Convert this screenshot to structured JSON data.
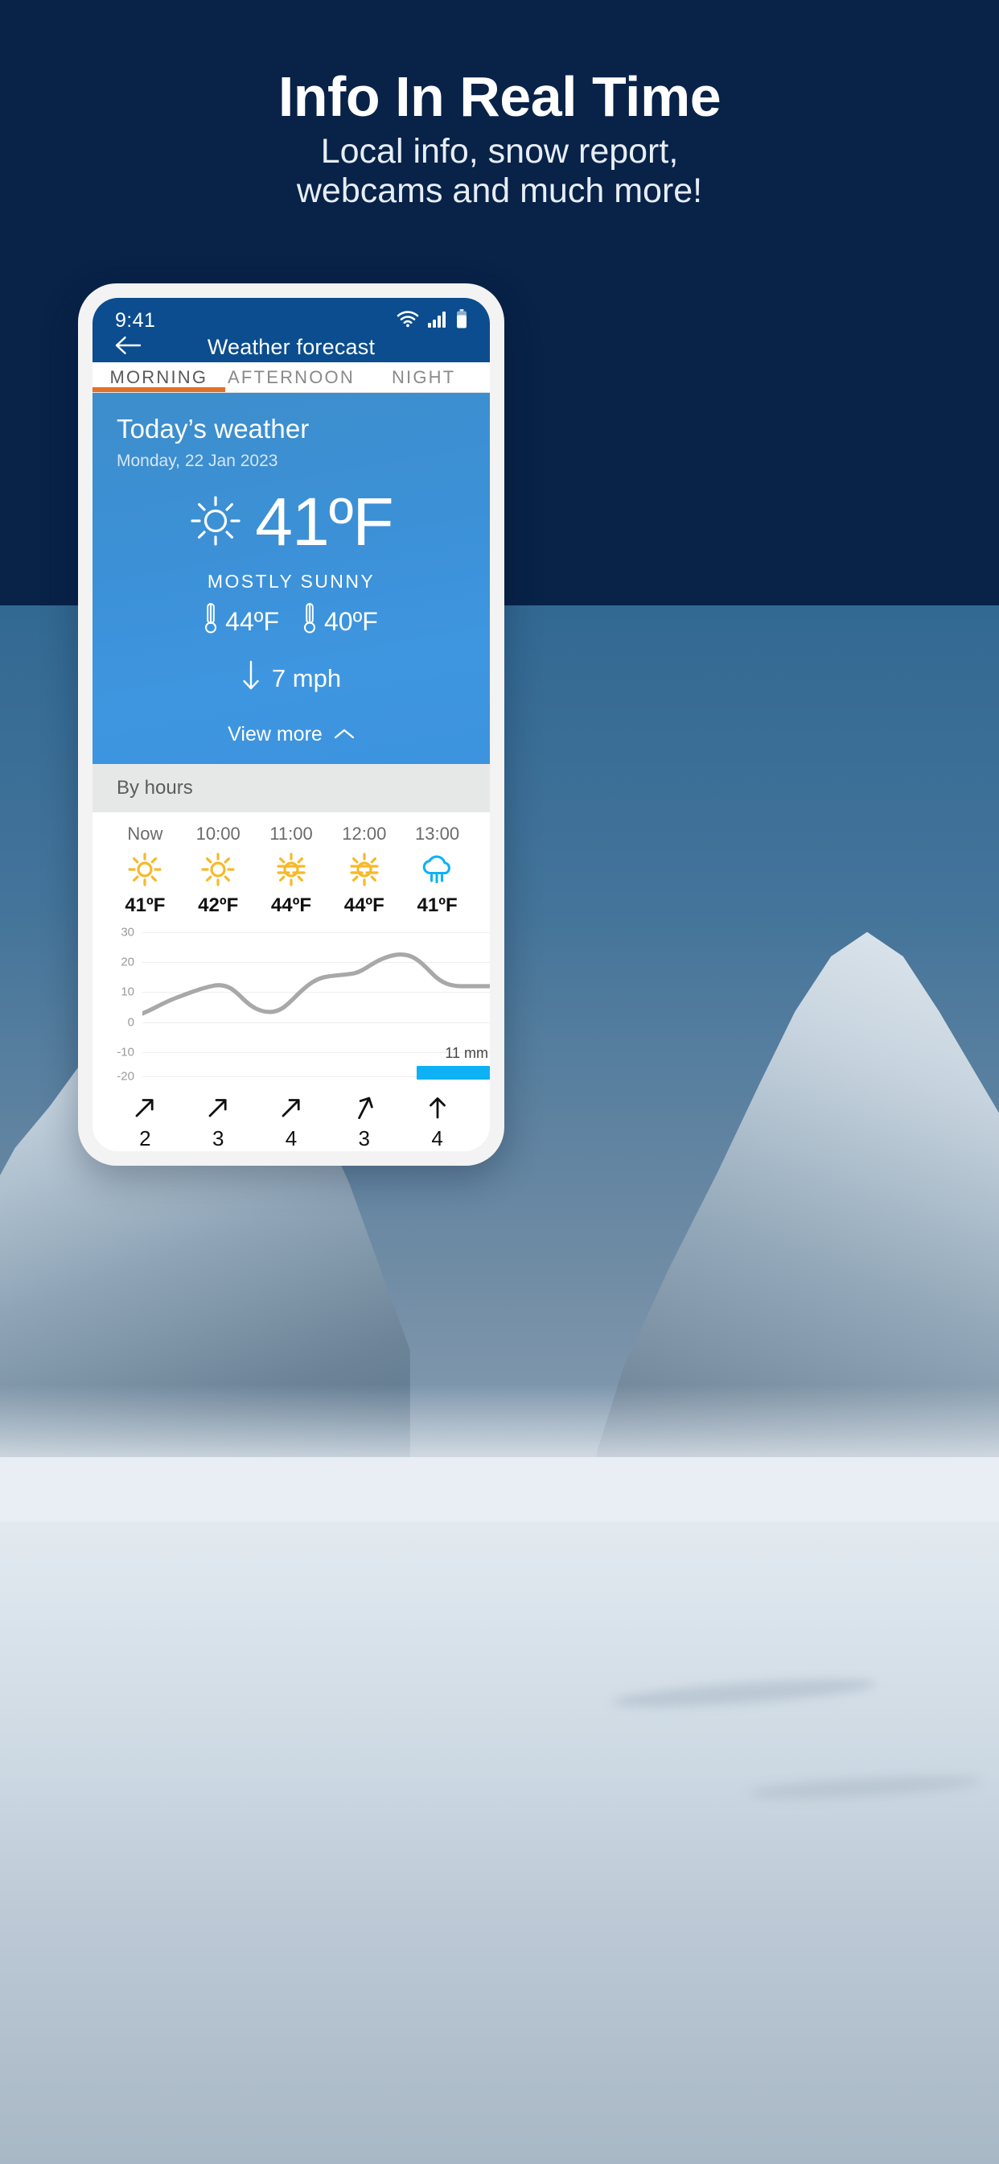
{
  "banner": {
    "title": "Info In Real Time",
    "subtitle_line1": "Local info, snow report,",
    "subtitle_line2": "webcams and much more!"
  },
  "phone": {
    "status": {
      "time": "9:41",
      "wifi_icon": "wifi-icon",
      "signal_icon": "cellular-signal-icon",
      "battery_icon": "battery-icon"
    },
    "appbar": {
      "back_icon": "back-arrow-icon",
      "title": "Weather forecast"
    },
    "tabs": [
      {
        "label": "MORNING",
        "active": true
      },
      {
        "label": "AFTERNOON",
        "active": false
      },
      {
        "label": "NIGHT",
        "active": false
      }
    ],
    "today": {
      "title": "Today’s weather",
      "date": "Monday, 22 Jan 2023",
      "icon": "sun-icon",
      "temperature": "41ºF",
      "condition": "MOSTLY SUNNY",
      "high_icon": "thermometer-icon",
      "high": "44ºF",
      "low_icon": "thermometer-icon",
      "low": "40ºF",
      "wind_icon": "arrow-down-icon",
      "wind": "7 mph",
      "view_more_label": "View more",
      "view_more_icon": "chevron-up-icon"
    },
    "by_hours": {
      "section_label": "By hours",
      "hours": [
        {
          "time": "Now",
          "icon": "sun-icon",
          "temp": "41ºF",
          "wind_dir_icon": "arrow-up-right-icon",
          "wind_speed": "2"
        },
        {
          "time": "10:00",
          "icon": "sun-icon",
          "temp": "42ºF",
          "wind_dir_icon": "arrow-up-right-icon",
          "wind_speed": "3"
        },
        {
          "time": "11:00",
          "icon": "sun-haze-icon",
          "temp": "44ºF",
          "wind_dir_icon": "arrow-up-right-icon",
          "wind_speed": "4"
        },
        {
          "time": "12:00",
          "icon": "sun-haze-icon",
          "temp": "44ºF",
          "wind_dir_icon": "arrow-up-right-icon",
          "wind_speed": "3"
        },
        {
          "time": "13:00",
          "icon": "rain-cloud-icon",
          "temp": "41ºF",
          "wind_dir_icon": "arrow-up-icon",
          "wind_speed": "4"
        }
      ]
    }
  },
  "colors": {
    "banner_bg": "#082248",
    "app_blue": "#0b4d8f",
    "card_blue": "#3d93dd",
    "tab_accent": "#e2712a",
    "rain_blue": "#0fb1f5",
    "sun_yellow": "#f7b928",
    "line_gray": "#a8a8a8"
  },
  "chart_data": {
    "type": "line",
    "title": "",
    "xlabel": "",
    "ylabel": "",
    "ylim": [
      -20,
      30
    ],
    "yticks": [
      30,
      20,
      10,
      0,
      -10,
      -20
    ],
    "ytick_labels": [
      "30",
      "20",
      "10",
      "0",
      "-10",
      "-20"
    ],
    "grid": true,
    "legend": "none",
    "x": [
      0,
      1,
      2,
      3,
      4,
      5,
      6,
      7,
      8,
      9,
      10,
      11
    ],
    "series": [
      {
        "name": "temperature",
        "color": "#a8a8a8",
        "values": [
          8,
          11,
          13.5,
          14,
          11,
          9,
          11,
          17,
          18,
          22,
          24,
          16,
          16
        ]
      }
    ],
    "bars": [
      {
        "label": "11 mm",
        "value": 11,
        "color": "#0fb1f5",
        "x_start": 0.78,
        "x_end": 0.98,
        "y_bottom": -20,
        "y_top": -17.5
      }
    ]
  }
}
